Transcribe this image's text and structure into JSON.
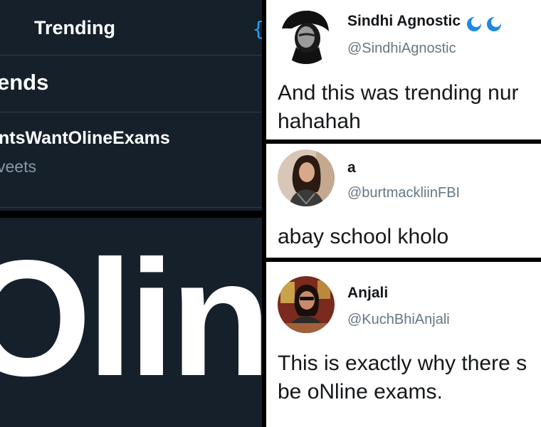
{
  "trending_screen": {
    "header_title": "Trending",
    "settings_glyph": "{",
    "section_label": "ends",
    "trend": {
      "hashtag": "ntsWantOlineExams",
      "count": "veets"
    }
  },
  "zoom": {
    "word": "Oline"
  },
  "tweets": [
    {
      "display_name": "Sindhi Agnostic",
      "name_emoji_icon": "water-wave-icon",
      "handle": "@SindhiAgnostic",
      "text_lines": [
        "And this was trending nur",
        "hahahah"
      ]
    },
    {
      "display_name": "a",
      "handle": "@burtmackliinFBI",
      "text_lines": [
        "abay school kholo"
      ]
    },
    {
      "display_name": "Anjali",
      "handle": "@KuchBhiAnjali",
      "text_lines": [
        "This is exactly why there s",
        "be oNline exams."
      ]
    }
  ],
  "colors": {
    "dark_bg": "#15202b",
    "divider": "#2f3b47",
    "muted_text": "#8899a6",
    "accent": "#1da1f2",
    "handle_gray": "#657786"
  }
}
